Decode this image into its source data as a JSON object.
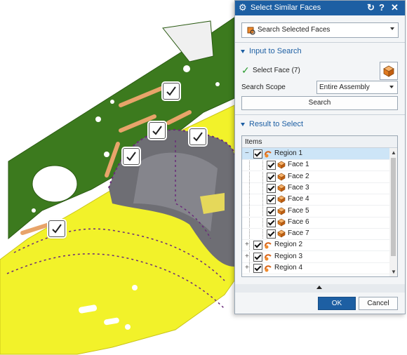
{
  "dialog": {
    "title": "Select Similar Faces",
    "controls": {
      "reset_icon": "reset-icon",
      "help_label": "?",
      "close_label": "✕"
    },
    "search_type": {
      "value": "Search Selected Faces",
      "icon": "face-search-icon"
    }
  },
  "input_section": {
    "title": "Input to Search",
    "select_face_label": "Select Face (7)",
    "scope_label": "Search Scope",
    "scope_value": "Entire Assembly",
    "search_button": "Search"
  },
  "result_section": {
    "title": "Result to Select",
    "column_header": "Items",
    "rows": [
      {
        "label": "Region 1",
        "level": 0,
        "expander": "−",
        "selected": true,
        "icon": "region-icon"
      },
      {
        "label": "Face 1",
        "level": 1,
        "icon": "face-icon"
      },
      {
        "label": "Face 2",
        "level": 1,
        "icon": "face-icon"
      },
      {
        "label": "Face 3",
        "level": 1,
        "icon": "face-icon"
      },
      {
        "label": "Face 4",
        "level": 1,
        "icon": "face-icon"
      },
      {
        "label": "Face 5",
        "level": 1,
        "icon": "face-icon"
      },
      {
        "label": "Face 6",
        "level": 1,
        "icon": "face-icon"
      },
      {
        "label": "Face 7",
        "level": 1,
        "icon": "face-icon"
      },
      {
        "label": "Region 2",
        "level": 0,
        "expander": "+",
        "icon": "region-icon"
      },
      {
        "label": "Region 3",
        "level": 0,
        "expander": "+",
        "icon": "region-icon"
      },
      {
        "label": "Region 4",
        "level": 0,
        "expander": "+",
        "icon": "region-icon"
      }
    ]
  },
  "buttons": {
    "ok": "OK",
    "cancel": "Cancel"
  },
  "colors": {
    "title_bar": "#1d5fa3",
    "model_green": "#3c7a1e",
    "model_yellow": "#f2f22a",
    "model_gray": "#6e6e74",
    "accent": "#1d5fa3"
  }
}
